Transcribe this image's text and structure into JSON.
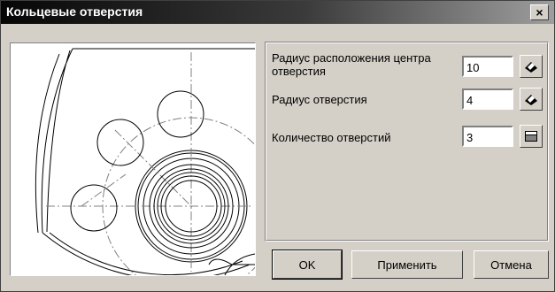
{
  "window": {
    "title": "Кольцевые отверстия",
    "close_label": "×"
  },
  "fields": [
    {
      "label": "Радиус расположения центра отверстия",
      "value": "10",
      "icon": "ruler-pick-icon"
    },
    {
      "label": "Радиус отверстия",
      "value": "4",
      "icon": "ruler-pick-icon"
    },
    {
      "label": "Количество отверстий",
      "value": "3",
      "icon": "calculator-icon"
    }
  ],
  "buttons": {
    "ok": "OK",
    "apply": "Применить",
    "cancel": "Отмена"
  }
}
